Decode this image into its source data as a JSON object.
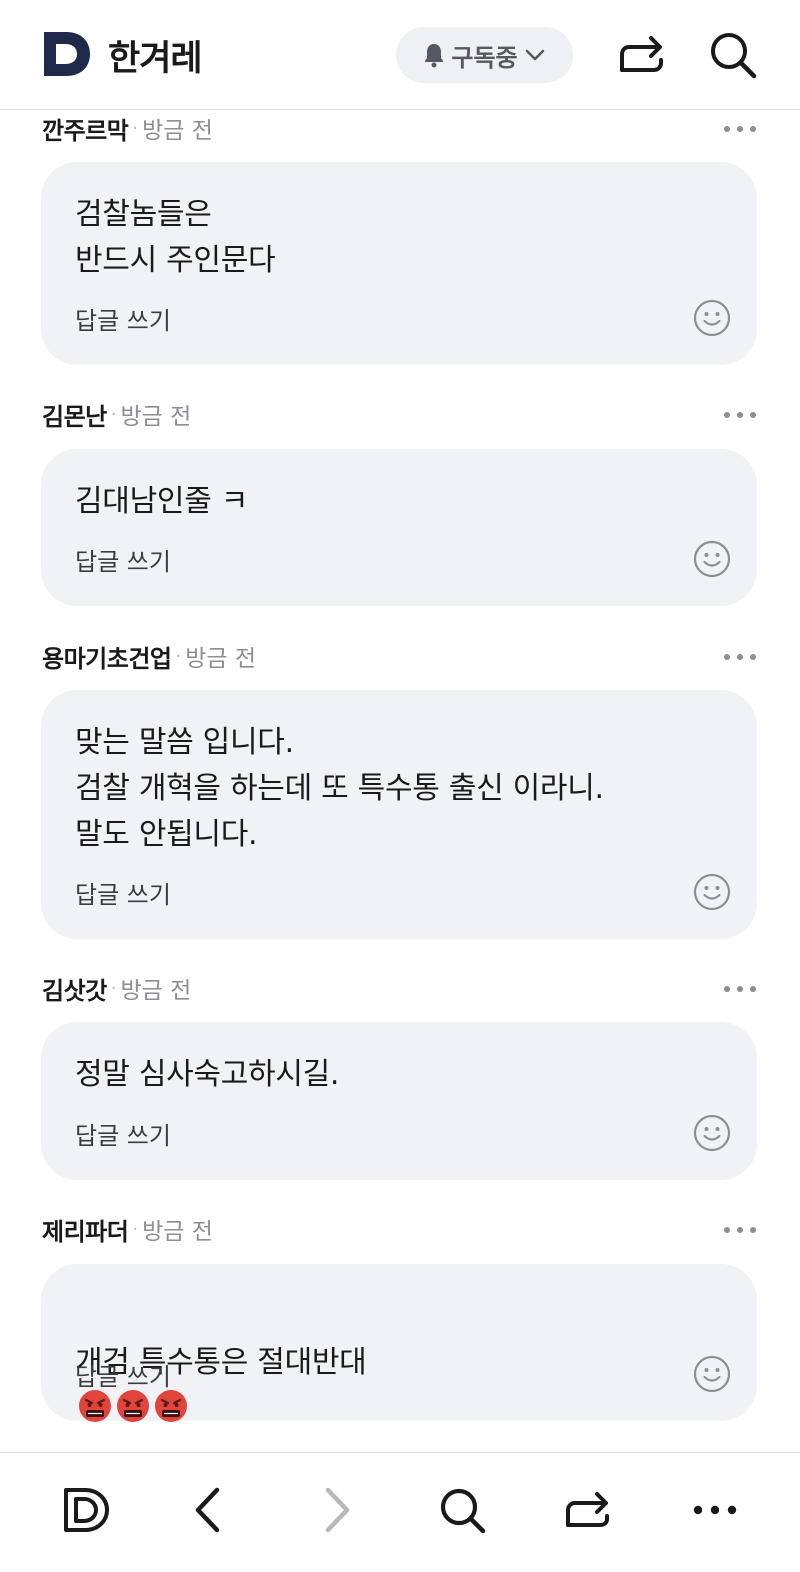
{
  "header": {
    "brand": "한겨레",
    "subscribe_label": "구독중"
  },
  "comments": [
    {
      "author": "깐주르막",
      "time": "방금 전",
      "text": "검찰놈들은\n반드시 주인문다",
      "reply_label": "답글 쓰기"
    },
    {
      "author": "김몬난",
      "time": "방금 전",
      "text": "김대남인줄 ㅋ",
      "reply_label": "답글 쓰기"
    },
    {
      "author": "용마기초건업",
      "time": "방금 전",
      "text": "맞는 말씀 입니다.\n검찰 개혁을 하는데 또 특수통 출신 이라니.\n말도 안됩니다.",
      "reply_label": "답글 쓰기"
    },
    {
      "author": "김삿갓",
      "time": "방금 전",
      "text": "정말 심사숙고하시길.",
      "reply_label": "답글 쓰기"
    },
    {
      "author": "제리파더",
      "time": "방금 전",
      "text": "개검 특수통은 절대반대",
      "reply_label": "답글 쓰기",
      "emojis": [
        "angry-face-icon",
        "angry-face-icon",
        "angry-face-icon"
      ]
    }
  ],
  "icons": {
    "logo": "hankyoreh-logo",
    "bell": "bell-icon",
    "chevron": "chevron-down-icon",
    "share": "share-icon",
    "search": "search-icon",
    "more": "more-icon",
    "emoji": "smiley-icon",
    "nav": [
      "d-logo-icon",
      "back-icon",
      "forward-icon",
      "search-icon",
      "share-icon",
      "more-icon"
    ]
  },
  "colors": {
    "bubble_bg": "#f1f2f6",
    "brand_navy": "#1f2a4a",
    "muted_text": "#8b8e96"
  }
}
